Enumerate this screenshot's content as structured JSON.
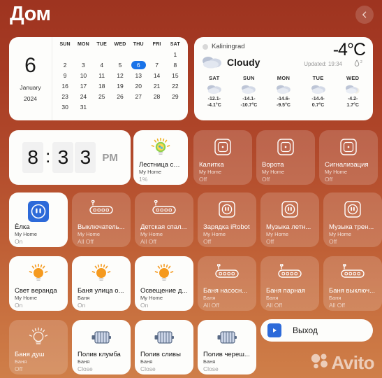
{
  "header": {
    "title": "Дом",
    "back_icon": "chevron-left-icon"
  },
  "calendar": {
    "day": "6",
    "month": "January",
    "year": "2024",
    "weekdays": [
      "SUN",
      "MON",
      "TUE",
      "WED",
      "THU",
      "FRI",
      "SAT"
    ],
    "leading_blanks": 6,
    "days": [
      1,
      2,
      3,
      4,
      5,
      6,
      7,
      8,
      9,
      10,
      11,
      12,
      13,
      14,
      15,
      16,
      17,
      18,
      19,
      20,
      21,
      22,
      23,
      24,
      25,
      26,
      27,
      28,
      29,
      30,
      31
    ],
    "selected_day": 6,
    "selected_color": "#1a73e8"
  },
  "weather": {
    "city": "Kaliningrad",
    "temperature": "-4°C",
    "condition": "Cloudy",
    "updated": "Updated: 19:34",
    "humidity": "2",
    "condition_icon": "cloud-icon",
    "forecast": [
      {
        "day": "SAT",
        "icon": "cloud-icon",
        "high": "-12.1-",
        "low": "-4.1°C"
      },
      {
        "day": "SUN",
        "icon": "cloud-icon",
        "high": "-14.1-",
        "low": "-10.7°C"
      },
      {
        "day": "MON",
        "icon": "cloud-icon",
        "high": "-14.6-",
        "low": "-9.5°C"
      },
      {
        "day": "TUE",
        "icon": "cloud-icon",
        "high": "-14.4-",
        "low": "0.7°C"
      },
      {
        "day": "WED",
        "icon": "cloud-sun-icon",
        "high": "-4.2-",
        "low": "1.7°C"
      }
    ]
  },
  "clock": {
    "hour": "8",
    "minute_tens": "3",
    "minute_ones": "3",
    "colon": ":",
    "ampm": "PM"
  },
  "tiles": [
    {
      "id": "stair-light",
      "name": "Лестница свет",
      "room": "My Home",
      "state": "1%",
      "icon": "color-bulb-icon",
      "on": true
    },
    {
      "id": "gate-wicket",
      "name": "Калитка",
      "room": "My Home",
      "state": "Off",
      "icon": "switch-button-icon",
      "on": false
    },
    {
      "id": "gate",
      "name": "Ворота",
      "room": "My Home",
      "state": "Off",
      "icon": "switch-button-icon",
      "on": false
    },
    {
      "id": "alarm",
      "name": "Сигнализация",
      "room": "My Home",
      "state": "Off",
      "icon": "switch-button-icon",
      "on": false
    },
    {
      "id": "christmas-tree",
      "name": "Ёлка",
      "room": "My Home",
      "state": "On",
      "icon": "outlet-icon-blue",
      "on": true
    },
    {
      "id": "switch-1",
      "name": "Выключатель...",
      "room": "My Home",
      "state": "All Off",
      "icon": "power-strip-icon",
      "on": false
    },
    {
      "id": "kids-bedroom",
      "name": "Детская спал...",
      "room": "My Home",
      "state": "All Off",
      "icon": "power-strip-icon",
      "on": false
    },
    {
      "id": "irobot-charge",
      "name": "Зарядка iRobot",
      "room": "My Home",
      "state": "Off",
      "icon": "outlet-icon",
      "on": false
    },
    {
      "id": "music-summer",
      "name": "Музыка летн...",
      "room": "My Home",
      "state": "Off",
      "icon": "outlet-icon",
      "on": false
    },
    {
      "id": "music-gym",
      "name": "Музыка трен...",
      "room": "My Home",
      "state": "Off",
      "icon": "outlet-icon",
      "on": false
    },
    {
      "id": "veranda-light",
      "name": "Свет веранда",
      "room": "My Home",
      "state": "On",
      "icon": "bulb-icon",
      "on": true
    },
    {
      "id": "banya-street",
      "name": "Баня улица о...",
      "room": "Баня",
      "state": "On",
      "icon": "bulb-icon",
      "on": true
    },
    {
      "id": "lighting-house",
      "name": "Освещение д...",
      "room": "My Home",
      "state": "On",
      "icon": "bulb-icon",
      "on": true
    },
    {
      "id": "banya-pump",
      "name": "Баня насосн...",
      "room": "Баня",
      "state": "All Off",
      "icon": "power-strip-icon",
      "on": false
    },
    {
      "id": "banya-steam",
      "name": "Баня парная",
      "room": "Баня",
      "state": "All Off",
      "icon": "power-strip-icon",
      "on": false
    },
    {
      "id": "banya-switch",
      "name": "Баня выключ...",
      "room": "Баня",
      "state": "All Off",
      "icon": "power-strip-icon",
      "on": false
    },
    {
      "id": "banya-shower",
      "name": "Баня душ",
      "room": "Баня",
      "state": "Off",
      "icon": "bulb-outline-icon",
      "on": false
    },
    {
      "id": "water-flower",
      "name": "Полив клумба",
      "room": "Баня",
      "state": "Close",
      "icon": "valve-icon",
      "on": true
    },
    {
      "id": "water-plum",
      "name": "Полив сливы",
      "room": "Баня",
      "state": "Close",
      "icon": "valve-icon",
      "on": true
    },
    {
      "id": "water-cherry",
      "name": "Полив череш...",
      "room": "Баня",
      "state": "Close",
      "icon": "valve-icon",
      "on": true
    }
  ],
  "scene": {
    "label": "Выход",
    "icon": "play-icon",
    "icon_color": "#2d6ad9"
  },
  "watermark": {
    "text": "Avito"
  }
}
